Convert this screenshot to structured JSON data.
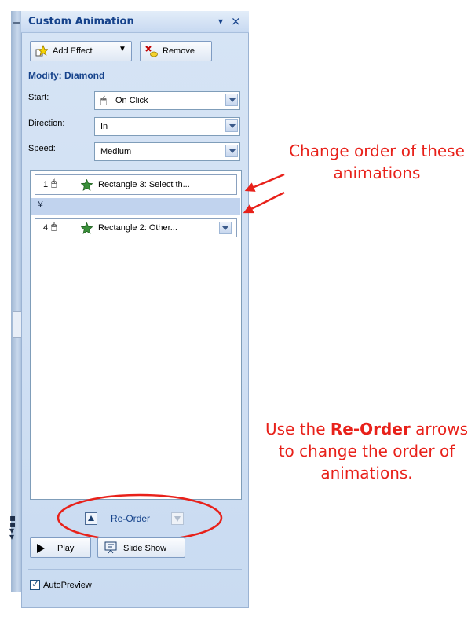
{
  "pane": {
    "title": "Custom Animation",
    "menu_glyph": "▾",
    "close_glyph": "×",
    "add_effect_label": "Add Effect",
    "remove_label": "Remove",
    "modify_label": "Modify: Diamond",
    "start_label": "Start:",
    "start_value": "On Click",
    "direction_label": "Direction:",
    "direction_value": "In",
    "speed_label": "Speed:",
    "speed_value": "Medium"
  },
  "animation_list": {
    "items": [
      {
        "number": "1",
        "label": "Rectangle 3: Select th..."
      },
      {
        "number": "4",
        "label": "Rectangle 2: Other..."
      }
    ]
  },
  "controls": {
    "reorder_label": "Re-Order",
    "play_label": "Play",
    "slideshow_label": "Slide Show",
    "autopreview_label": "AutoPreview",
    "autopreview_checked": "✓"
  },
  "annotations": {
    "note1": "Change order of these animations",
    "note2_before": "Use the ",
    "note2_bold": "Re-Order",
    "note2_after": " arrows to change the order of animations."
  },
  "colors": {
    "annotation_red": "#e8211a",
    "pane_title_blue": "#15428b"
  }
}
